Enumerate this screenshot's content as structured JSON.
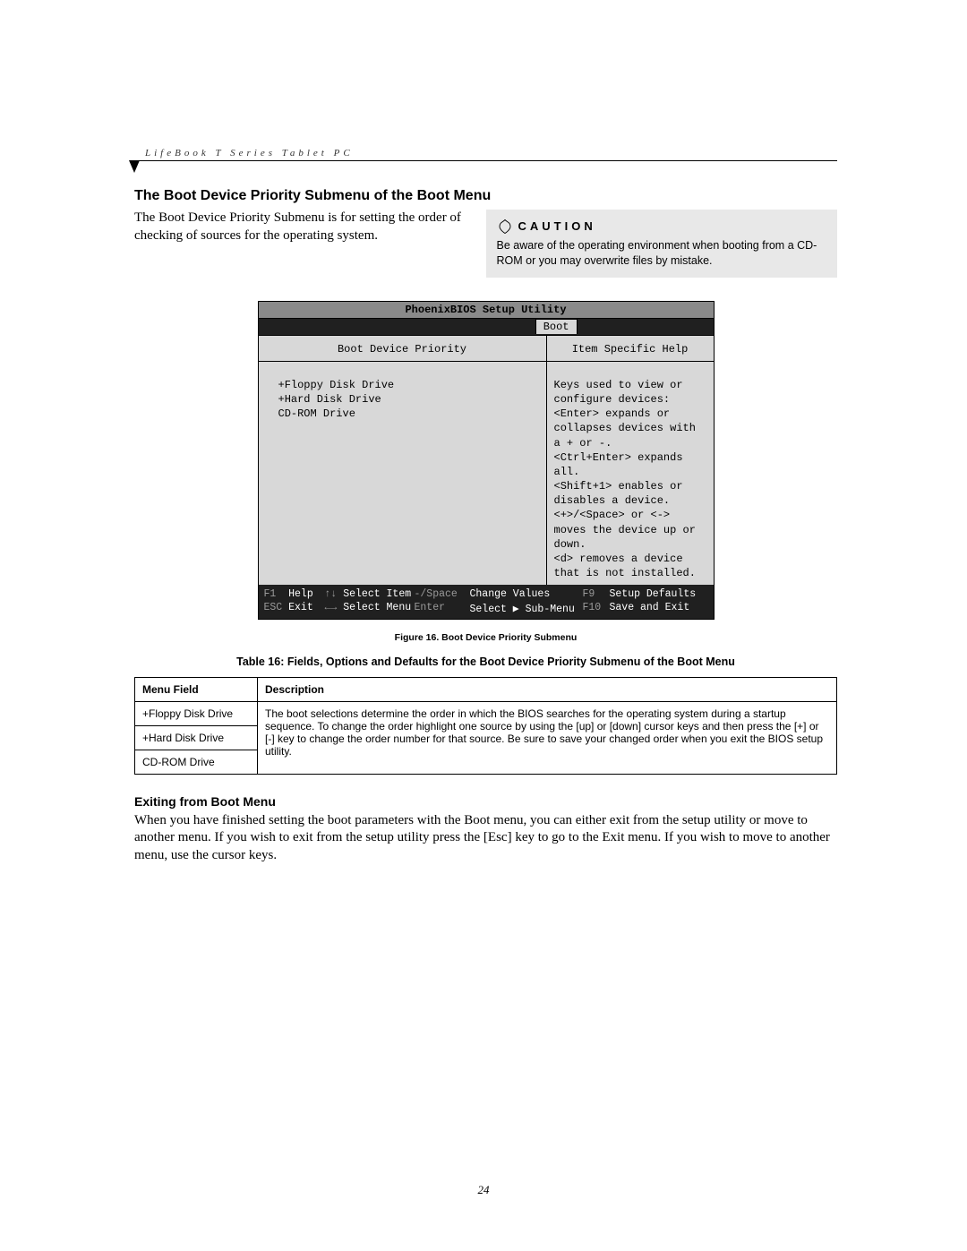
{
  "header": {
    "running_head": "LifeBook T Series Tablet PC"
  },
  "section": {
    "title": "The Boot Device Priority Submenu of the Boot Menu",
    "intro": "The Boot Device Priority Submenu is for setting the order of checking of sources for the operating system."
  },
  "caution": {
    "label": "CAUTION",
    "body": "Be aware of the operating environment when booting from a CD-ROM or you may overwrite files by mistake."
  },
  "bios": {
    "title": "PhoenixBIOS Setup Utility",
    "active_tab": "Boot",
    "left_header": "Boot Device Priority",
    "boot_items": [
      "+Floppy Disk Drive",
      "+Hard Disk Drive",
      " CD-ROM Drive"
    ],
    "right_header": "Item Specific Help",
    "help_lines": [
      "Keys used to view or",
      "configure devices:",
      "",
      "<Enter> expands or",
      "collapses devices with",
      "a + or -.",
      "<Ctrl+Enter> expands",
      "all.",
      "<Shift+1> enables or",
      "disables a device.",
      "<+>/<Space> or <->",
      "moves the device up or",
      "down.",
      "<d> removes a device",
      "that is not installed."
    ],
    "footer": {
      "r1c1_key": "F1",
      "r1c1_lbl": "Help",
      "r1c2_key": "↑↓",
      "r1c2_lbl": "Select Item",
      "r1c3_key": "-/Space",
      "r1c3_lbl": "Change Values",
      "r1c4_key": "F9",
      "r1c4_lbl": "Setup Defaults",
      "r2c1_key": "ESC",
      "r2c1_lbl": "Exit",
      "r2c2_key": "←→",
      "r2c2_lbl": "Select Menu",
      "r2c3_key": "Enter",
      "r2c3_lbl": "Select ▶ Sub-Menu",
      "r2c4_key": "F10",
      "r2c4_lbl": "Save and Exit"
    }
  },
  "figure_caption": "Figure 16.  Boot Device Priority Submenu",
  "table_caption": "Table 16: Fields, Options and Defaults for the Boot Device Priority Submenu of the Boot Menu",
  "table": {
    "col_menu_field": "Menu Field",
    "col_description": "Description",
    "rows": [
      {
        "field": "+Floppy Disk Drive"
      },
      {
        "field": "+Hard Disk Drive"
      },
      {
        "field": "CD-ROM Drive"
      }
    ],
    "description": "The boot selections determine the order in which the BIOS searches for the operating system during a startup sequence. To change the order highlight one source by using the [up] or [down] cursor keys and then press the [+] or [-] key to change the order number for that source. Be sure to save your changed order when you exit the BIOS setup utility."
  },
  "exit": {
    "heading": "Exiting from Boot Menu",
    "body": "When you have finished setting the boot parameters with the Boot menu, you can either exit from the setup utility or move to another menu. If you wish to exit from the setup utility press the [Esc] key to go to the Exit menu. If you wish to move to another menu, use the cursor keys."
  },
  "page_number": "24"
}
